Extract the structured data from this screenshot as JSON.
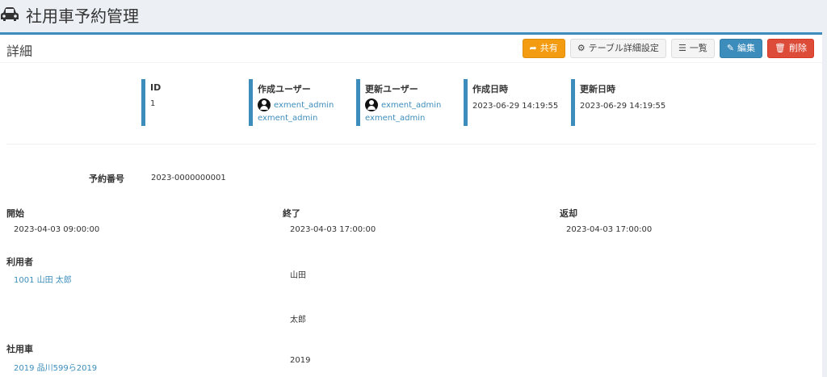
{
  "app": {
    "title": "社用車予約管理",
    "icon": "car-icon"
  },
  "box": {
    "title": "詳細"
  },
  "toolbar": {
    "share": "共有",
    "table_setting": "テーブル詳細設定",
    "list": "一覧",
    "edit": "編集",
    "delete": "削除"
  },
  "meta": {
    "id_label": "ID",
    "id_value": "1",
    "creator_label": "作成ユーザー",
    "creator_name": "exment_admin",
    "creator_sub": "exment_admin",
    "updater_label": "更新ユーザー",
    "updater_name": "exment_admin",
    "updater_sub": "exment_admin",
    "created_label": "作成日時",
    "created_value": "2023-06-29 14:19:55",
    "updated_label": "更新日時",
    "updated_value": "2023-06-29 14:19:55"
  },
  "fields": {
    "reserve_no_label": "予約番号",
    "reserve_no_value": "2023-0000000001",
    "start_label": "開始",
    "start_value": "2023-04-03 09:00:00",
    "end_label": "終了",
    "end_value": "2023-04-03 17:00:00",
    "return_label": "返却",
    "return_value": "2023-04-03 17:00:00",
    "user_label": "利用者",
    "user_value": "1001 山田 太郎",
    "last_name": "山田",
    "first_name": "太郎",
    "car_label": "社用車",
    "car_value": "2019 品川599ら2019",
    "car_no": "2019"
  },
  "colors": {
    "primary": "#3c8dbc",
    "warning": "#f39c12",
    "danger": "#dd4b39"
  }
}
